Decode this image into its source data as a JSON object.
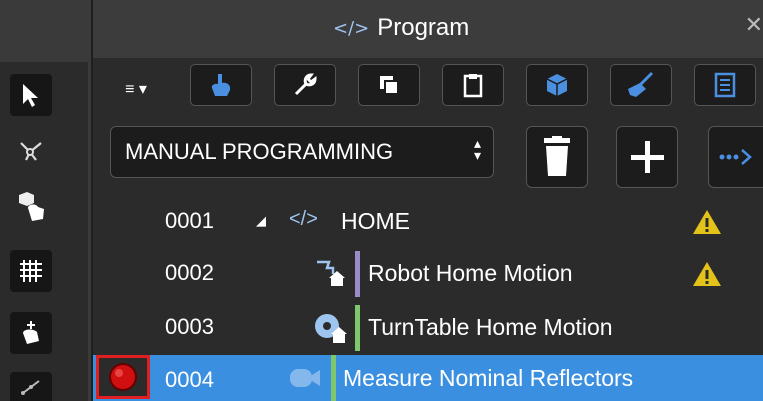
{
  "panel": {
    "title": "Program",
    "title_icon": "code-icon"
  },
  "toolbar": {
    "buttons": [
      "menu-dropdown-icon",
      "robot-arm-icon",
      "wrench-icon",
      "copy-icon",
      "clipboard-icon",
      "cube-icon",
      "broom-icon",
      "list-icon"
    ]
  },
  "program_select": {
    "value": "MANUAL PROGRAMMING"
  },
  "rows": [
    {
      "num": "0001",
      "label": "HOME",
      "icon": "code-icon",
      "bar_color": "",
      "warning": true
    },
    {
      "num": "0002",
      "label": "Robot Home Motion",
      "icon": "robot-home-icon",
      "bar_color": "#9b8cc8",
      "warning": true
    },
    {
      "num": "0003",
      "label": "TurnTable Home Motion",
      "icon": "turntable-home-icon",
      "bar_color": "#7fc76b",
      "warning": false
    },
    {
      "num": "0004",
      "label": "Measure Nominal Reflectors",
      "icon": "camera-icon",
      "bar_color": "#7fc76b",
      "warning": false
    }
  ],
  "colors": {
    "accent": "#4a8fe0",
    "selected_row": "#3b8fe0",
    "warning": "#e3c21a",
    "record_red": "#d01010"
  }
}
